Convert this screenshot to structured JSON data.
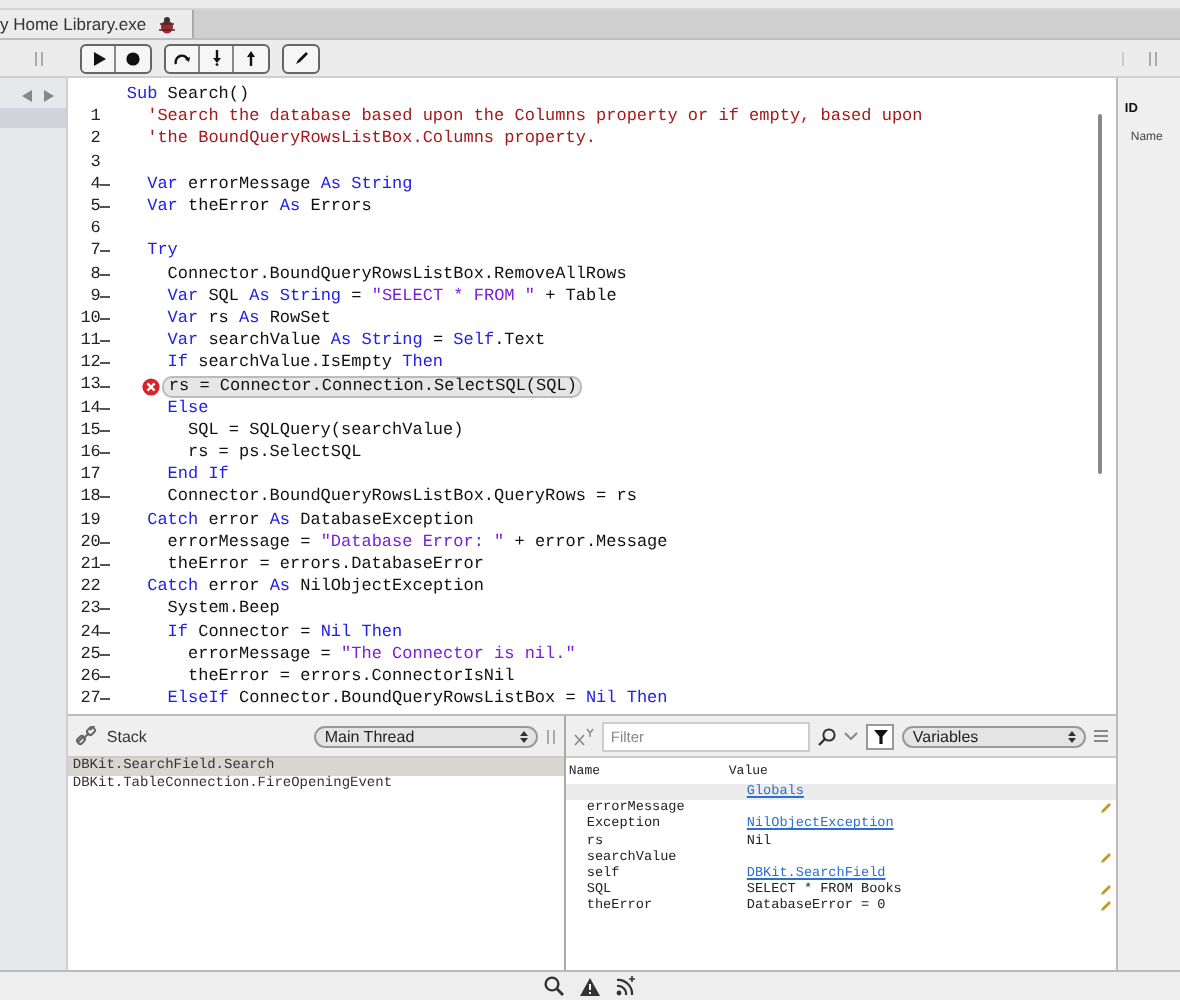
{
  "tab": {
    "title": "y Home Library.exe",
    "selected": true
  },
  "code": {
    "lines": [
      {
        "fold": false,
        "error": false,
        "tokens": [
          {
            "kind": "keyword",
            "t": "Sub"
          },
          {
            "kind": "text",
            "t": " Search()"
          }
        ]
      },
      {
        "number": "1",
        "fold": false,
        "error": false,
        "tokens": [
          {
            "kind": "comment",
            "t": "  'Search the database based upon the Columns property or if empty, based upon"
          }
        ]
      },
      {
        "number": "2",
        "fold": false,
        "error": false,
        "tokens": [
          {
            "kind": "comment",
            "t": "  'the BoundQueryRowsListBox.Columns property."
          }
        ]
      },
      {
        "number": "3",
        "fold": false,
        "error": false
      },
      {
        "number": "4",
        "fold": true,
        "error": false,
        "tokens": [
          {
            "kind": "keyword",
            "t": "  Var"
          },
          {
            "kind": "text",
            "t": " errorMessage "
          },
          {
            "kind": "keyword",
            "t": "As"
          },
          {
            "kind": "keyword",
            "t": " String"
          }
        ]
      },
      {
        "number": "5",
        "fold": true,
        "error": false,
        "tokens": [
          {
            "kind": "keyword",
            "t": "  Var"
          },
          {
            "kind": "text",
            "t": " theError "
          },
          {
            "kind": "keyword",
            "t": "As"
          },
          {
            "kind": "text",
            "t": " Errors"
          }
        ]
      },
      {
        "number": "6",
        "fold": false,
        "error": false
      },
      {
        "number": "7",
        "fold": true,
        "error": false,
        "tokens": [
          {
            "kind": "keyword",
            "t": "  Try"
          }
        ]
      },
      {
        "number": "8",
        "fold": true,
        "error": false,
        "tokens": [
          {
            "kind": "text",
            "t": "    Connector.BoundQueryRowsListBox.RemoveAllRows"
          }
        ]
      },
      {
        "number": "9",
        "fold": true,
        "error": false,
        "tokens": [
          {
            "kind": "keyword",
            "t": "    Var"
          },
          {
            "kind": "text",
            "t": " SQL "
          },
          {
            "kind": "keyword",
            "t": "As"
          },
          {
            "kind": "keyword",
            "t": " String"
          },
          {
            "kind": "text",
            "t": " = "
          },
          {
            "kind": "string",
            "t": "\"SELECT * FROM \""
          },
          {
            "kind": "text",
            "t": " + Table"
          }
        ]
      },
      {
        "number": "10",
        "fold": true,
        "error": false,
        "tokens": [
          {
            "kind": "keyword",
            "t": "    Var"
          },
          {
            "kind": "text",
            "t": " rs "
          },
          {
            "kind": "keyword",
            "t": "As"
          },
          {
            "kind": "text",
            "t": " RowSet"
          }
        ]
      },
      {
        "number": "11",
        "fold": true,
        "error": false,
        "tokens": [
          {
            "kind": "keyword",
            "t": "    Var"
          },
          {
            "kind": "text",
            "t": " searchValue "
          },
          {
            "kind": "keyword",
            "t": "As"
          },
          {
            "kind": "keyword",
            "t": " String"
          },
          {
            "kind": "text",
            "t": " = "
          },
          {
            "kind": "keyword",
            "t": "Self"
          },
          {
            "kind": "text",
            "t": ".Text"
          }
        ]
      },
      {
        "number": "12",
        "fold": true,
        "error": false,
        "tokens": [
          {
            "kind": "keyword",
            "t": "    If"
          },
          {
            "kind": "text",
            "t": " searchValue.IsEmpty "
          },
          {
            "kind": "keyword",
            "t": "Then"
          }
        ]
      },
      {
        "number": "13",
        "fold": true,
        "error": true,
        "tokens": [
          {
            "kind": "text",
            "t": "rs = Connector.Connection.SelectSQL(SQL)"
          }
        ]
      },
      {
        "number": "14",
        "fold": true,
        "error": false,
        "tokens": [
          {
            "kind": "keyword",
            "t": "    Else"
          }
        ]
      },
      {
        "number": "15",
        "fold": true,
        "error": false,
        "tokens": [
          {
            "kind": "text",
            "t": "      SQL = SQLQuery(searchValue)"
          }
        ]
      },
      {
        "number": "16",
        "fold": true,
        "error": false,
        "tokens": [
          {
            "kind": "text",
            "t": "      rs = ps.SelectSQL"
          }
        ]
      },
      {
        "number": "17",
        "fold": false,
        "error": false,
        "tokens": [
          {
            "kind": "keyword",
            "t": "    End If"
          }
        ]
      },
      {
        "number": "18",
        "fold": true,
        "error": false,
        "tokens": [
          {
            "kind": "text",
            "t": "    Connector.BoundQueryRowsListBox.QueryRows = rs"
          }
        ]
      },
      {
        "number": "19",
        "fold": false,
        "error": false,
        "tokens": [
          {
            "kind": "keyword",
            "t": "  Catch"
          },
          {
            "kind": "text",
            "t": " error "
          },
          {
            "kind": "keyword",
            "t": "As"
          },
          {
            "kind": "text",
            "t": " DatabaseException"
          }
        ]
      },
      {
        "number": "20",
        "fold": true,
        "error": false,
        "tokens": [
          {
            "kind": "text",
            "t": "    errorMessage = "
          },
          {
            "kind": "string",
            "t": "\"Database Error: \""
          },
          {
            "kind": "text",
            "t": " + error.Message"
          }
        ]
      },
      {
        "number": "21",
        "fold": true,
        "error": false,
        "tokens": [
          {
            "kind": "text",
            "t": "    theError = errors.DatabaseError"
          }
        ]
      },
      {
        "number": "22",
        "fold": false,
        "error": false,
        "tokens": [
          {
            "kind": "keyword",
            "t": "  Catch"
          },
          {
            "kind": "text",
            "t": " error "
          },
          {
            "kind": "keyword",
            "t": "As"
          },
          {
            "kind": "text",
            "t": " NilObjectException"
          }
        ]
      },
      {
        "number": "23",
        "fold": true,
        "error": false,
        "tokens": [
          {
            "kind": "text",
            "t": "    System.Beep"
          }
        ]
      },
      {
        "number": "24",
        "fold": true,
        "error": false,
        "tokens": [
          {
            "kind": "keyword",
            "t": "    If"
          },
          {
            "kind": "text",
            "t": " Connector = "
          },
          {
            "kind": "keyword",
            "t": "Nil"
          },
          {
            "kind": "keyword",
            "t": " Then"
          }
        ]
      },
      {
        "number": "25",
        "fold": true,
        "error": false,
        "tokens": [
          {
            "kind": "text",
            "t": "      errorMessage = "
          },
          {
            "kind": "string",
            "t": "\"The Connector is nil.\""
          }
        ]
      },
      {
        "number": "26",
        "fold": true,
        "error": false,
        "tokens": [
          {
            "kind": "text",
            "t": "      theError = errors.ConnectorIsNil"
          }
        ]
      },
      {
        "number": "27",
        "fold": true,
        "error": false,
        "tokens": [
          {
            "kind": "keyword",
            "t": "    ElseIf"
          },
          {
            "kind": "text",
            "t": " Connector.BoundQueryRowsListBox = "
          },
          {
            "kind": "keyword",
            "t": "Nil"
          },
          {
            "kind": "keyword",
            "t": " Then"
          }
        ]
      }
    ]
  },
  "inspector": {
    "heading": "ID",
    "label": "Name"
  },
  "stack": {
    "title": "Stack",
    "thread": "Main Thread",
    "frames": [
      {
        "label": "DBKit.SearchField.Search",
        "selected": true
      },
      {
        "label": "DBKit.TableConnection.FireOpeningEvent",
        "selected": false
      }
    ]
  },
  "variables": {
    "filter": {
      "placeholder": "Filter"
    },
    "scope": "Variables",
    "columns": [
      "Name",
      "Value"
    ],
    "rows": [
      {
        "kind": "group",
        "value": "Globals",
        "link": true,
        "editable": false
      },
      {
        "kind": "item",
        "name": "errorMessage",
        "link": false,
        "editable": true
      },
      {
        "kind": "item",
        "name": "Exception",
        "value": "NilObjectException",
        "link": true,
        "editable": false
      },
      {
        "kind": "item",
        "name": "rs",
        "value": "Nil",
        "link": false,
        "editable": false
      },
      {
        "kind": "item",
        "name": "searchValue",
        "link": false,
        "editable": true
      },
      {
        "kind": "item",
        "name": "self",
        "value": "DBKit.SearchField",
        "link": true,
        "editable": false
      },
      {
        "kind": "item",
        "name": "SQL",
        "value": "SELECT * FROM Books",
        "link": false,
        "editable": true
      },
      {
        "kind": "item",
        "name": "theError",
        "value": "DatabaseError = 0",
        "link": false,
        "editable": true
      }
    ]
  }
}
